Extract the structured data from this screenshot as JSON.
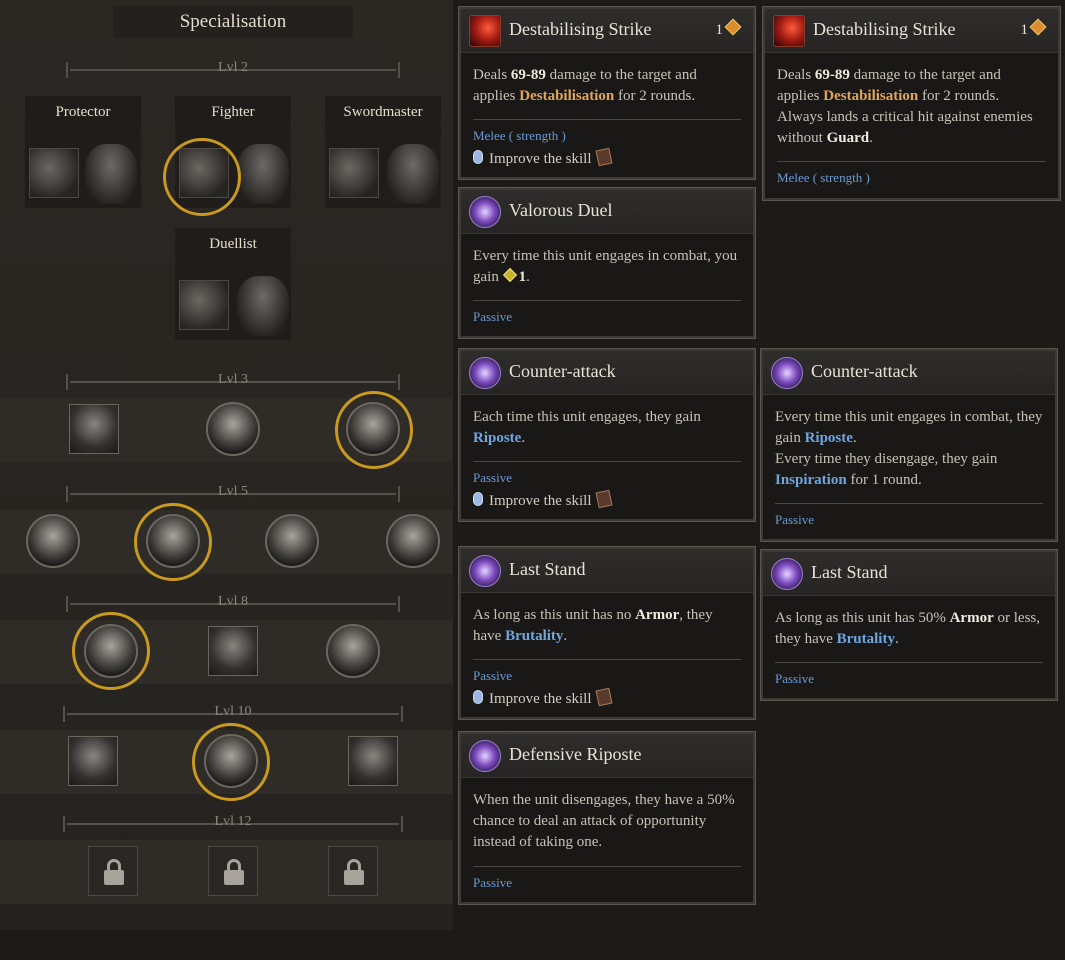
{
  "spec": {
    "title": "Specialisation",
    "levels": [
      "Lvl 2",
      "Lvl 3",
      "Lvl 5",
      "Lvl 8",
      "Lvl 10",
      "Lvl 12"
    ],
    "classes": [
      "Protector",
      "Fighter",
      "Swordmaster",
      "Duellist"
    ]
  },
  "tooltips": [
    {
      "title": "Destabilising Strike",
      "cost": "1",
      "desc": [
        "Deals ",
        "69-89",
        " damage to the target and applies ",
        "Destabilisation",
        " for 2 rounds."
      ],
      "kind": "Melee ( strength )",
      "improve": "Improve the skill"
    },
    {
      "title": "Destabilising Strike",
      "cost": "1",
      "desc": [
        "Deals ",
        "69-89",
        " damage to the target and applies ",
        "Destabilisation",
        " for 2 rounds. Always lands a critical hit against enemies without ",
        "Guard",
        "."
      ],
      "kind": "Melee ( strength )"
    },
    {
      "title": "Valorous Duel",
      "desc": [
        "Every time this unit engages in combat, you gain ",
        "1",
        "."
      ],
      "kind": "Passive"
    },
    {
      "title": "Counter-attack",
      "desc": [
        "Each time this unit engages, they gain ",
        "Riposte",
        "."
      ],
      "kind": "Passive",
      "improve": "Improve the skill"
    },
    {
      "title": "Counter-attack",
      "desc": [
        "Every time this unit engages in combat, they gain ",
        "Riposte",
        ".",
        "Every time they disengage, they gain ",
        "Inspiration",
        " for 1 round."
      ],
      "kind": "Passive"
    },
    {
      "title": "Last Stand",
      "desc": [
        "As long as this unit has no ",
        "Armor",
        ", they have ",
        "Brutality",
        "."
      ],
      "kind": "Passive",
      "improve": "Improve the skill"
    },
    {
      "title": "Last Stand",
      "desc": [
        "As long as this unit has 50% ",
        "Armor",
        " or less, they have ",
        "Brutality",
        "."
      ],
      "kind": "Passive"
    },
    {
      "title": "Defensive Riposte",
      "desc": [
        "When the unit disengages, they have a 50% chance to deal an attack of opportunity instead of taking one."
      ],
      "kind": "Passive"
    }
  ]
}
